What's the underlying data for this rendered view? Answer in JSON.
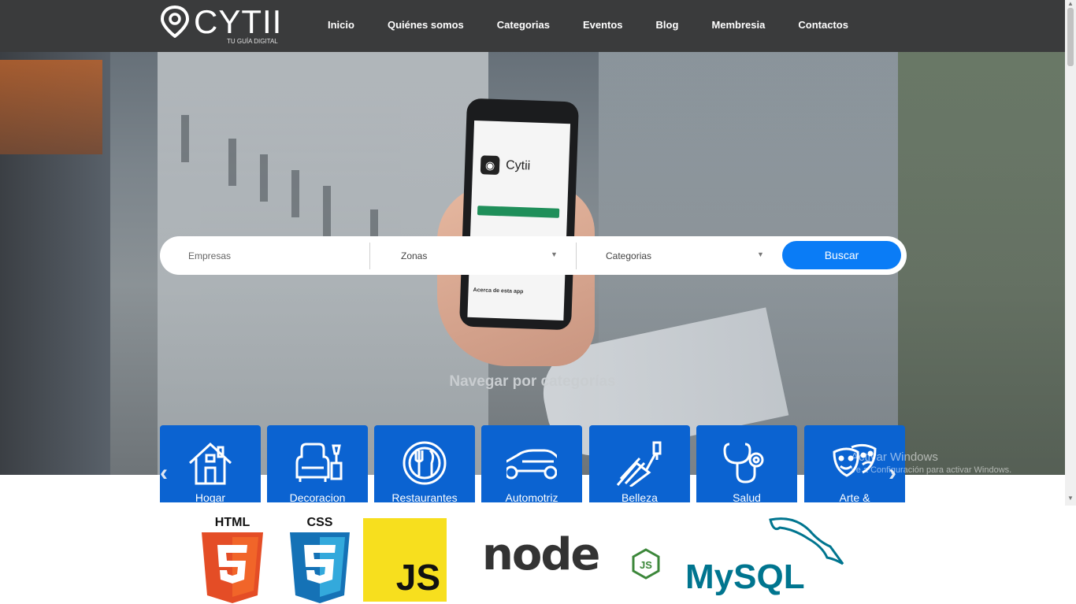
{
  "brand": {
    "name": "CYTII",
    "tagline": "TU GUÍA DIGITAL"
  },
  "nav": [
    "Inicio",
    "Quiénes somos",
    "Categorias",
    "Eventos",
    "Blog",
    "Membresia",
    "Contactos"
  ],
  "hero": {
    "phone_app_name": "Cytii",
    "phone_about": "Acerca de esta app"
  },
  "search": {
    "placeholder": "Empresas",
    "zone_select": "Zonas",
    "category_select": "Categorias",
    "button_label": "Buscar"
  },
  "categories_heading": "Navegar por categorías",
  "categories": [
    {
      "label": "Hogar",
      "icon": "house-icon"
    },
    {
      "label": "Decoracion",
      "icon": "armchair-lamp-icon"
    },
    {
      "label": "Restaurantes",
      "icon": "plate-cutlery-icon"
    },
    {
      "label": "Automotriz",
      "icon": "car-icon"
    },
    {
      "label": "Belleza",
      "icon": "hair-dryer-icon"
    },
    {
      "label": "Salud",
      "icon": "stethoscope-icon"
    },
    {
      "label": "Arte & Entretenimiento",
      "icon": "theater-masks-icon"
    }
  ],
  "watermark": {
    "line1": "Activar Windows",
    "line2": "Ve a Configuración para activar Windows."
  },
  "tech_logos": [
    "HTML",
    "CSS",
    "JS",
    "node",
    "MySQL"
  ],
  "colors": {
    "header": "#3a3b3c",
    "accent": "#0a7cf6",
    "card": "#0b63d1"
  }
}
